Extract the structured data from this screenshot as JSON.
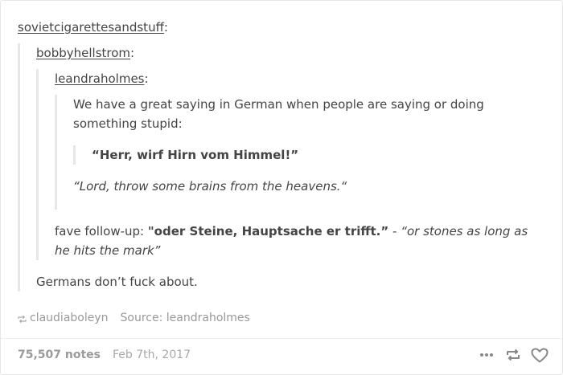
{
  "post": {
    "users": {
      "level1": "sovietcigarettesandstuff",
      "level2": "bobbyhellstrom",
      "level3": "leandraholmes"
    },
    "colon": ":",
    "leandra_text_line1": "We have a great saying in German when people are saying or doing",
    "leandra_text_line2": "something stupid:",
    "german_saying": "“Herr, wirf Hirn vom Himmel!”",
    "translation": "“Lord, throw some brains from the heavens.“",
    "followup_prefix": "fave follow-up: ",
    "followup_german": "\"oder Steine, Hauptsache er trifft.”",
    "followup_separator": " - ",
    "followup_translation": "“or stones as long as he hits the mark”",
    "bobby_reply": "Germans don’t fuck about."
  },
  "source": {
    "reblogged_from": "claudiaboleyn",
    "source_text": "Source: leandraholmes"
  },
  "footer": {
    "notes": "75,507 notes",
    "date": "Feb 7th, 2017"
  },
  "icons": {
    "reblog_source": "reblog-icon",
    "more": "more-dots-icon",
    "reblog": "reblog-icon",
    "like": "heart-icon"
  },
  "colors": {
    "text": "#444444",
    "meta": "#999999",
    "quote_border": "#e7e7e7"
  }
}
